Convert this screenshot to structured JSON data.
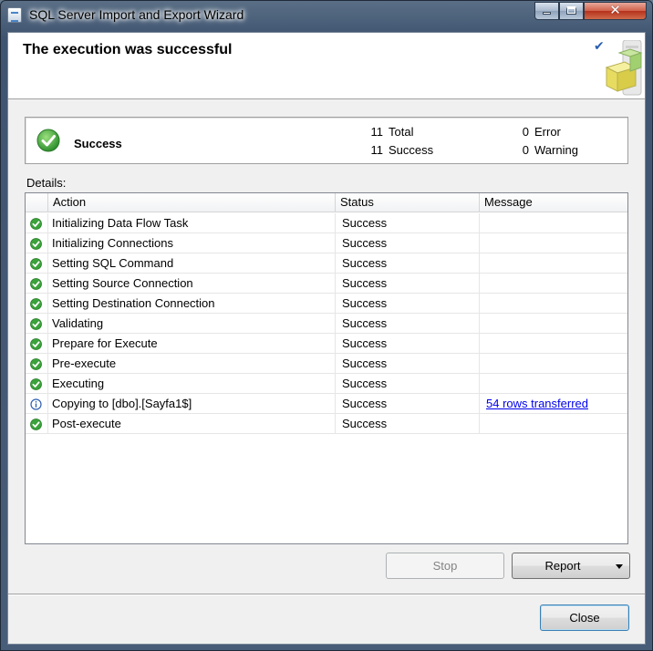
{
  "window": {
    "title": "SQL Server Import and Export Wizard",
    "controls": {
      "minimize": "minimize",
      "maximize": "maximize",
      "close": "close"
    }
  },
  "header": {
    "title": "The execution was successful"
  },
  "summary": {
    "status": "Success",
    "total_count": "11",
    "total_label": "Total",
    "success_count": "11",
    "success_label": "Success",
    "error_count": "0",
    "error_label": "Error",
    "warning_count": "0",
    "warning_label": "Warning"
  },
  "details": {
    "label": "Details:",
    "columns": {
      "action": "Action",
      "status": "Status",
      "message": "Message"
    },
    "rows": [
      {
        "icon": "success-icon",
        "action": "Initializing Data Flow Task",
        "status": "Success",
        "message": ""
      },
      {
        "icon": "success-icon",
        "action": "Initializing Connections",
        "status": "Success",
        "message": ""
      },
      {
        "icon": "success-icon",
        "action": "Setting SQL Command",
        "status": "Success",
        "message": ""
      },
      {
        "icon": "success-icon",
        "action": "Setting Source Connection",
        "status": "Success",
        "message": ""
      },
      {
        "icon": "success-icon",
        "action": "Setting Destination Connection",
        "status": "Success",
        "message": ""
      },
      {
        "icon": "success-icon",
        "action": "Validating",
        "status": "Success",
        "message": ""
      },
      {
        "icon": "success-icon",
        "action": "Prepare for Execute",
        "status": "Success",
        "message": ""
      },
      {
        "icon": "success-icon",
        "action": "Pre-execute",
        "status": "Success",
        "message": ""
      },
      {
        "icon": "success-icon",
        "action": "Executing",
        "status": "Success",
        "message": ""
      },
      {
        "icon": "info-icon",
        "action": "Copying to [dbo].[Sayfa1$]",
        "status": "Success",
        "message": "54 rows transferred"
      },
      {
        "icon": "success-icon",
        "action": "Post-execute",
        "status": "Success",
        "message": ""
      }
    ]
  },
  "buttons": {
    "stop": "Stop",
    "report": "Report",
    "close": "Close"
  },
  "colors": {
    "success_green": "#3aa23a",
    "info_blue": "#2f5fb3",
    "link": "#0000ee"
  }
}
